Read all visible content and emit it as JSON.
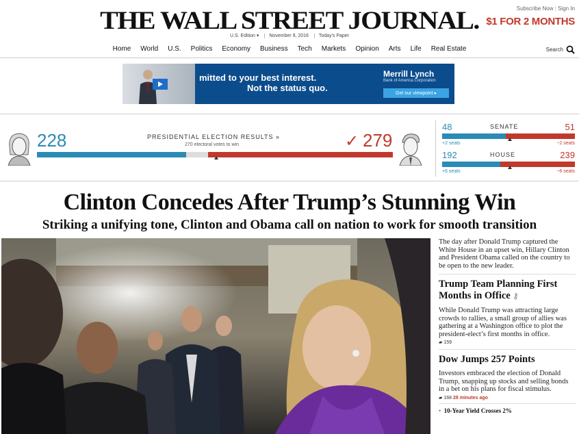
{
  "header": {
    "masthead": "THE WALL STREET JOURNAL.",
    "edition": "U.S. Edition ▾",
    "date": "November 9, 2016",
    "todays_paper": "Today's Paper",
    "subscribe": "Subscribe Now",
    "signin": "Sign In",
    "promo": "$1 FOR 2 MONTHS",
    "search_label": "Search"
  },
  "nav": [
    "Home",
    "World",
    "U.S.",
    "Politics",
    "Economy",
    "Business",
    "Tech",
    "Markets",
    "Opinion",
    "Arts",
    "Life",
    "Real Estate"
  ],
  "ad": {
    "line1": "mitted to your best interest.",
    "line2": "Not the status quo.",
    "brand": "Merrill Lynch",
    "brand_sub": "Bank of America Corporation",
    "cta": "Get our viewpoint ▸"
  },
  "election": {
    "title": "PRESIDENTIAL ELECTION RESULTS »",
    "subtitle": "270 electoral votes to win",
    "clinton_votes": "228",
    "trump_votes": "279",
    "clinton_fraction": 0.42,
    "trump_fraction": 0.52,
    "senate": {
      "label": "SENATE",
      "dem": "48",
      "rep": "51",
      "dem_seats": "+2 seats",
      "rep_seats": "−2 seats",
      "dem_fraction": 0.48
    },
    "house": {
      "label": "HOUSE",
      "dem": "192",
      "rep": "239",
      "dem_seats": "+6 seats",
      "rep_seats": "−6 seats",
      "dem_fraction": 0.44
    }
  },
  "main": {
    "headline": "Clinton Concedes After Trump’s Stunning Win",
    "subhead": "Striking a unifying tone, Clinton and Obama call on nation to work for smooth transition"
  },
  "rightcol": {
    "lead": "The day after Donald Trump captured the White House in an upset win, Hillary Clinton and President Obama called on the country to be open to the new leader.",
    "story1": {
      "head": "Trump Team Planning First Months in Office",
      "text": "While Donald Trump was attracting large crowds to rallies, a small group of allies was gathering at a Washington office to plot the president-elect’s first months in office.",
      "comments": "159"
    },
    "story2": {
      "head": "Dow Jumps 257 Points",
      "text": "Investors embraced the election of Donald Trump, snapping up stocks and selling bonds in a bet on his plans for fiscal stimulus.",
      "comments": "168",
      "time": "28 minutes ago",
      "bullet": "10-Year Yield Crosses 2%"
    }
  }
}
